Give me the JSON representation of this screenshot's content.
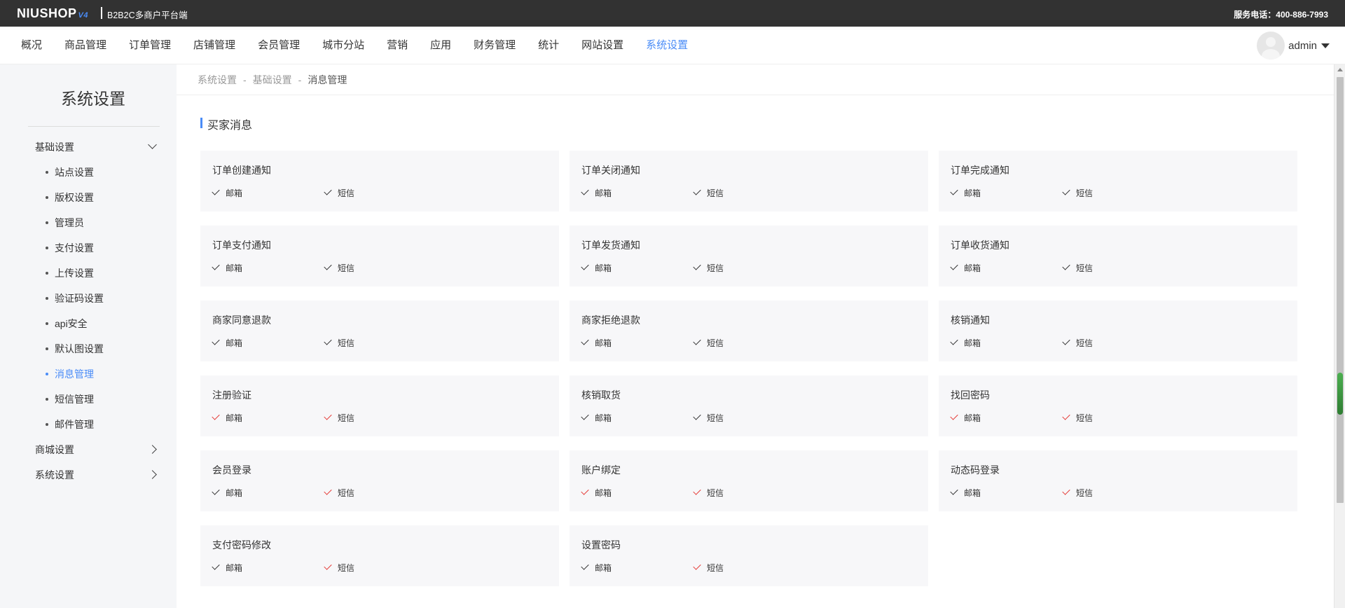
{
  "topbar": {
    "logo": "NIUSHOP",
    "logo_version": "V4",
    "platform": "B2B2C多商户平台端",
    "service": "服务电话：400-886-7993"
  },
  "nav": {
    "items": [
      "概况",
      "商品管理",
      "订单管理",
      "店铺管理",
      "会员管理",
      "城市分站",
      "营销",
      "应用",
      "财务管理",
      "统计",
      "网站设置",
      "系统设置"
    ],
    "active": "系统设置",
    "username": "admin"
  },
  "sidebar": {
    "title": "系统设置",
    "group_basic": "基础设置",
    "sub_items": [
      "站点设置",
      "版权设置",
      "管理员",
      "支付设置",
      "上传设置",
      "验证码设置",
      "api安全",
      "默认图设置",
      "消息管理",
      "短信管理",
      "邮件管理"
    ],
    "active_sub": "消息管理",
    "group_mall": "商城设置",
    "group_system": "系统设置"
  },
  "breadcrumb": {
    "level1": "系统设置",
    "level2": "基础设置",
    "level3": "消息管理",
    "separator": "-"
  },
  "section": {
    "title": "买家消息"
  },
  "option_labels": {
    "email": "邮箱",
    "sms": "短信"
  },
  "messages": [
    {
      "title": "订单创建通知",
      "email_enabled": false,
      "sms_enabled": false
    },
    {
      "title": "订单关闭通知",
      "email_enabled": false,
      "sms_enabled": false
    },
    {
      "title": "订单完成通知",
      "email_enabled": false,
      "sms_enabled": false
    },
    {
      "title": "订单支付通知",
      "email_enabled": false,
      "sms_enabled": false
    },
    {
      "title": "订单发货通知",
      "email_enabled": false,
      "sms_enabled": false
    },
    {
      "title": "订单收货通知",
      "email_enabled": false,
      "sms_enabled": false
    },
    {
      "title": "商家同意退款",
      "email_enabled": false,
      "sms_enabled": false
    },
    {
      "title": "商家拒绝退款",
      "email_enabled": false,
      "sms_enabled": false
    },
    {
      "title": "核销通知",
      "email_enabled": false,
      "sms_enabled": false
    },
    {
      "title": "注册验证",
      "email_enabled": true,
      "sms_enabled": true
    },
    {
      "title": "核销取货",
      "email_enabled": false,
      "sms_enabled": false
    },
    {
      "title": "找回密码",
      "email_enabled": true,
      "sms_enabled": true
    },
    {
      "title": "会员登录",
      "email_enabled": false,
      "sms_enabled": true
    },
    {
      "title": "账户绑定",
      "email_enabled": true,
      "sms_enabled": true
    },
    {
      "title": "动态码登录",
      "email_enabled": false,
      "sms_enabled": true
    },
    {
      "title": "支付密码修改",
      "email_enabled": false,
      "sms_enabled": true
    },
    {
      "title": "设置密码",
      "email_enabled": false,
      "sms_enabled": true
    }
  ],
  "colors": {
    "accent": "#4a8cf7",
    "enabled_check": "#e53935",
    "topbar_bg": "#323232"
  }
}
